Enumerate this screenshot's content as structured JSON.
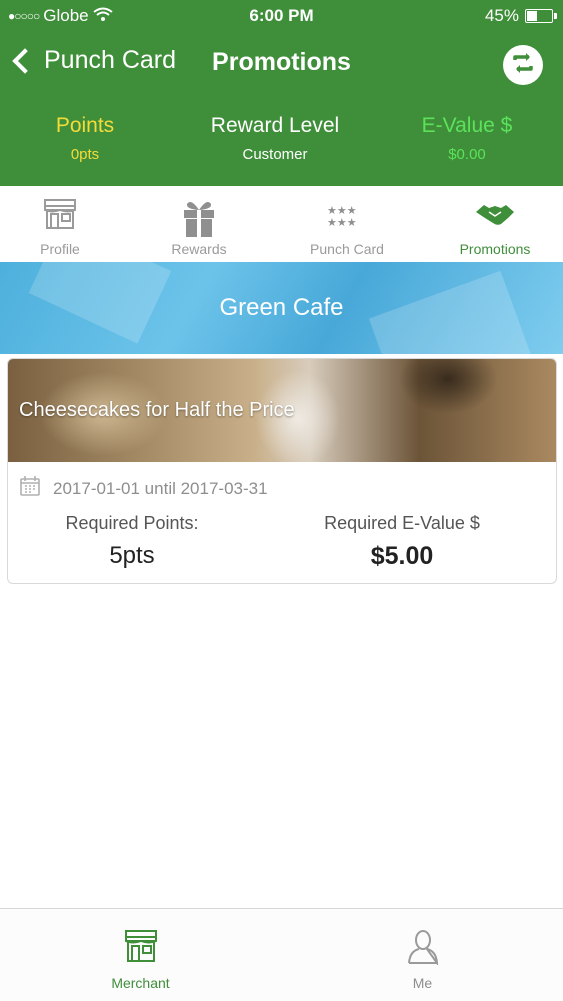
{
  "status_bar": {
    "carrier": "Globe",
    "time": "6:00 PM",
    "battery_percent": "45%",
    "battery_level": 0.45,
    "signal_dots": "●○○○○"
  },
  "nav": {
    "back_label": "Punch Card",
    "title": "Promotions",
    "refresh_icon": "refresh-icon"
  },
  "stats": {
    "points_label": "Points",
    "points_value": "0pts",
    "level_label": "Reward Level",
    "level_value": "Customer",
    "evalue_label": "E-Value $",
    "evalue_value": "$0.00",
    "points_color": "#f3dc3a",
    "evalue_color": "#5ce25a"
  },
  "tabs": [
    {
      "label": "Profile",
      "icon": "store-icon",
      "active": false
    },
    {
      "label": "Rewards",
      "icon": "gift-icon",
      "active": false
    },
    {
      "label": "Punch Card",
      "icon": "stars-icon",
      "active": false
    },
    {
      "label": "Promotions",
      "icon": "handshake-icon",
      "active": true
    }
  ],
  "banner": {
    "merchant_name": "Green Cafe"
  },
  "promotion": {
    "title": "Cheesecakes for Half the Price",
    "date_range": "2017-01-01 until 2017-03-31",
    "required_points_label": "Required Points:",
    "required_points_value": "5pts",
    "required_evalue_label": "Required  E-Value $",
    "required_evalue_value": "$5.00"
  },
  "bottom_nav": [
    {
      "label": "Merchant",
      "icon": "store-icon",
      "active": true
    },
    {
      "label": "Me",
      "icon": "person-icon",
      "active": false
    }
  ],
  "colors": {
    "brand_green": "#3f8e3a",
    "banner_blue": "#5bb8e4"
  }
}
